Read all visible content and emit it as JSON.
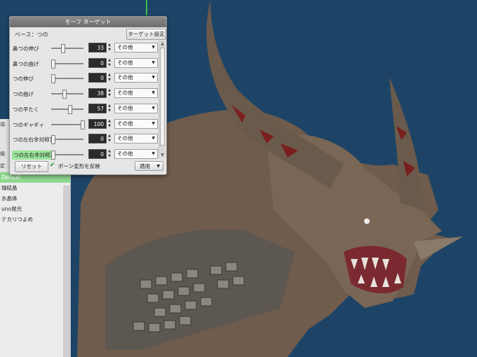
{
  "morph_window": {
    "title": "モーフ ターゲット",
    "base_label": "ベース：つの",
    "target_settings_label": "ターゲット設定",
    "rows": [
      {
        "label": "鼻つの伸び",
        "value": "33",
        "level": 0.33,
        "category": "その他"
      },
      {
        "label": "鼻つの曲げ",
        "value": "0",
        "level": 0.0,
        "category": "その他"
      },
      {
        "label": "つの伸び",
        "value": "0",
        "level": 0.0,
        "category": "その他"
      },
      {
        "label": "つの曲げ",
        "value": "38",
        "level": 0.38,
        "category": "その他"
      },
      {
        "label": "つの平たく",
        "value": "57",
        "level": 0.57,
        "category": "その他"
      },
      {
        "label": "つのギャギィ",
        "value": "100",
        "level": 1.0,
        "category": "その他"
      },
      {
        "label": "つの左右非対称1",
        "value": "0",
        "level": 0.0,
        "category": "その他"
      },
      {
        "label": "つの左右非対称2",
        "value": "0",
        "level": 0.0,
        "category": "その他",
        "highlighted": true
      }
    ],
    "reset_label": "リセット",
    "bone_checkbox_label": "ボーン変形を反映",
    "bone_checkbox_checked": true,
    "apply_label": "適用"
  },
  "left_panel": {
    "tabs": [
      "項",
      "規",
      "定"
    ],
    "items": [
      {
        "label": "Default",
        "selected": true
      },
      {
        "label": "瑚結晶",
        "selected": false
      },
      {
        "label": "水晶体",
        "selected": false
      },
      {
        "label": "uno発光",
        "selected": false
      },
      {
        "label": "テカリつよめ",
        "selected": false
      }
    ]
  },
  "colors": {
    "background": "#1d4466",
    "creature_skin": "#7a6655",
    "highlight_green": "#9be69b",
    "selected_green": "#8fd88f"
  },
  "icons": {
    "checkbox": "checkmark-icon",
    "dropdown": "chevron-down-icon",
    "spinner": "spinner-arrows-icon"
  }
}
